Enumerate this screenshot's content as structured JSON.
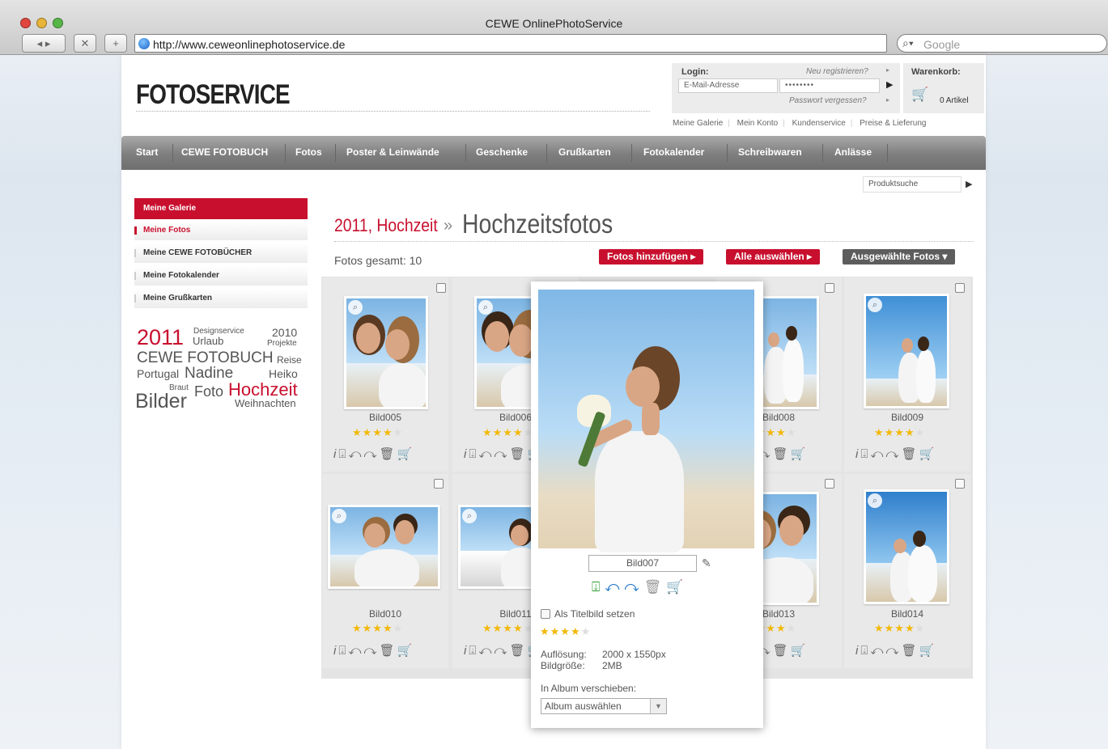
{
  "browser": {
    "title": "CEWE OnlinePhotoService",
    "url": "http://www.ceweonlinephotoservice.de",
    "search_placeholder": "Google"
  },
  "header": {
    "logo": "FOTOSERVICE",
    "login": {
      "label": "Login:",
      "register": "Neu registrieren?",
      "email_placeholder": "E-Mail-Adresse",
      "password_value": "••••••••",
      "forgot": "Passwort vergessen?"
    },
    "cart": {
      "label": "Warenkorb:",
      "count": "0 Artikel"
    },
    "links": [
      "Meine Galerie",
      "Mein Konto",
      "Kundenservice",
      "Preise & Lieferung"
    ]
  },
  "nav": [
    "Start",
    "CEWE FOTOBUCH",
    "Fotos",
    "Poster & Leinwände",
    "Geschenke",
    "Grußkarten",
    "Fotokalender",
    "Schreibwaren",
    "Anlässe"
  ],
  "product_search": "Produktsuche",
  "sidebar": {
    "items": [
      "Meine Galerie",
      "Meine Fotos",
      "Meine CEWE FOTOBÜCHER",
      "Meine Fotokalender",
      "Meine Grußkarten"
    ]
  },
  "tags": {
    "t2011": "2011",
    "designservice": "Designservice",
    "t2010": "2010",
    "urlaub": "Urlaub",
    "projekte": "Projekte",
    "fotobuch": "CEWE FOTOBUCH",
    "reise": "Reise",
    "portugal": "Portugal",
    "nadine": "Nadine",
    "heiko": "Heiko",
    "braut": "Braut",
    "foto": "Foto",
    "hochzeit": "Hochzeit",
    "bilder": "Bilder",
    "weihnachten": "Weihnachten"
  },
  "main": {
    "crumb_parent": "2011, Hochzeit",
    "crumb_sep": "»",
    "crumb_current": "Hochzeitsfotos",
    "total": "Fotos gesamt: 10",
    "btn_add": "Fotos hinzufügen ▸",
    "btn_select_all": "Alle auswählen ▸",
    "btn_selected": "Ausgewählte Fotos ▾"
  },
  "photos": [
    {
      "name": "Bild005",
      "rating": 4
    },
    {
      "name": "Bild006",
      "rating": 4
    },
    {
      "name": "Bild008",
      "rating": 4
    },
    {
      "name": "Bild009",
      "rating": 4
    },
    {
      "name": "Bild010",
      "rating": 4
    },
    {
      "name": "Bild011",
      "rating": 4
    },
    {
      "name": "Bild013",
      "rating": 4
    },
    {
      "name": "Bild014",
      "rating": 4
    }
  ],
  "popup": {
    "name": "Bild007",
    "titel_label": "Als Titelbild setzen",
    "rating": 4,
    "res_label": "Auflösung:",
    "res_value": "2000 x 1550px",
    "size_label": "Bildgröße:",
    "size_value": "2MB",
    "album_label": "In Album verschieben:",
    "album_select": "Album auswählen"
  },
  "colors": {
    "brand_red": "#c8102e",
    "nav_grey": "#7e7e7e",
    "star": "#f2b90a"
  }
}
